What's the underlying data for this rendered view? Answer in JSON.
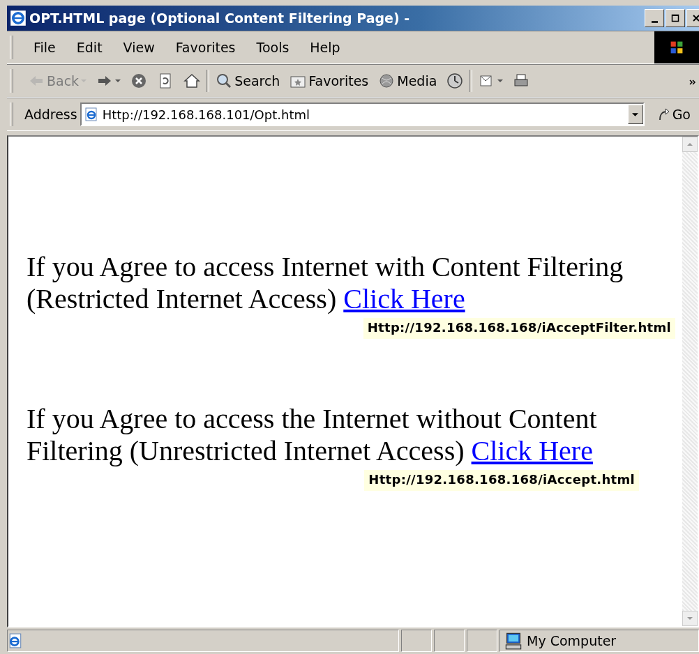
{
  "window": {
    "title": "OPT.HTML page (Optional Content Filtering Page) -"
  },
  "menu": [
    "File",
    "Edit",
    "View",
    "Favorites",
    "Tools",
    "Help"
  ],
  "toolbar": [
    {
      "kind": "back",
      "label": "Back",
      "disabled": true,
      "dropdown": true
    },
    {
      "kind": "forward",
      "disabled": false,
      "dropdown": true
    },
    {
      "kind": "stop",
      "disabled": false,
      "dropdown": false
    },
    {
      "kind": "refresh",
      "disabled": false,
      "dropdown": false
    },
    {
      "kind": "home",
      "disabled": false,
      "dropdown": false
    },
    {
      "kind": "search",
      "label": "Search",
      "disabled": false,
      "dropdown": false
    },
    {
      "kind": "favorites",
      "label": "Favorites",
      "disabled": false,
      "dropdown": false
    },
    {
      "kind": "media",
      "label": "Media",
      "disabled": false,
      "dropdown": false
    },
    {
      "kind": "history",
      "disabled": false,
      "dropdown": false
    },
    {
      "kind": "mail",
      "disabled": false,
      "dropdown": true
    },
    {
      "kind": "print",
      "disabled": false,
      "dropdown": false
    }
  ],
  "address": {
    "label": "Address",
    "value": "Http://192.168.168.101/Opt.html",
    "go": "Go"
  },
  "content": [
    {
      "text": "If you Agree to access Internet with Content Filtering (Restricted Internet Access)",
      "link": "Click Here",
      "tooltip": "Http://192.168.168.168/iAcceptFilter.html"
    },
    {
      "text": "If you Agree to access the Internet without Content Filtering (Unrestricted Internet Access)",
      "link": "Click Here",
      "tooltip": "Http://192.168.168.168/iAccept.html"
    }
  ],
  "status_bar": {
    "zone": "My Computer"
  }
}
